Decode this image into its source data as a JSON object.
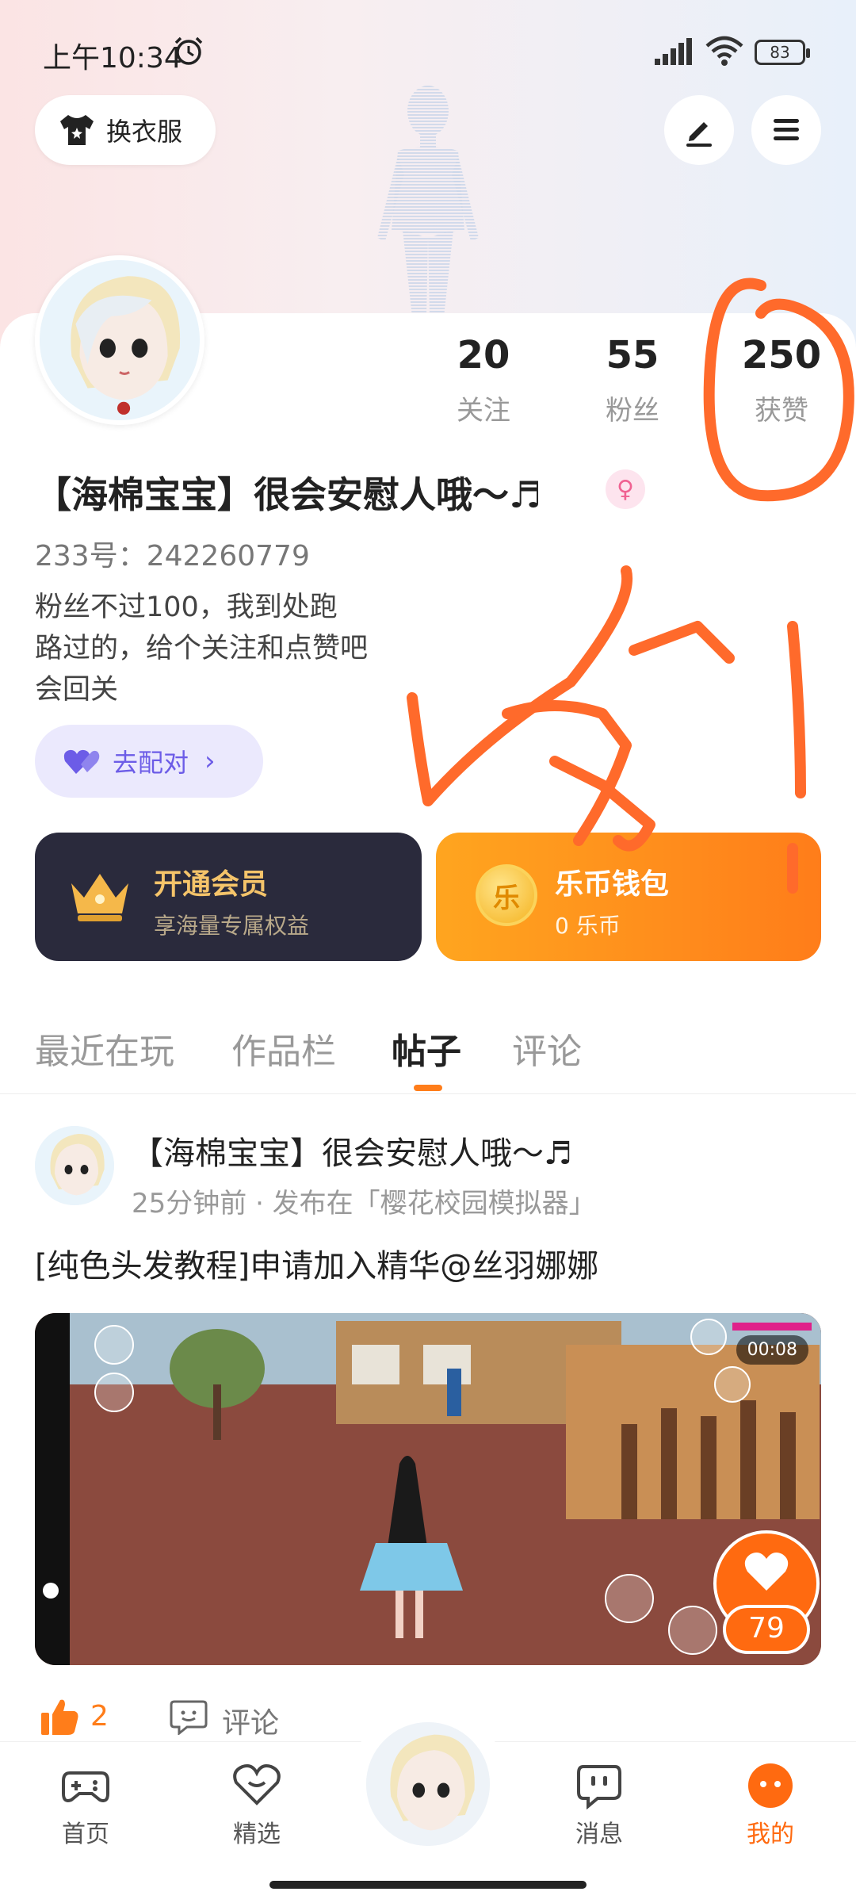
{
  "status_bar": {
    "time": "上午10:34",
    "battery": "83",
    "icons": [
      "alarm-icon",
      "signal-icon",
      "wifi-icon",
      "battery-icon"
    ]
  },
  "header": {
    "outfit_button": "换衣服",
    "icons": [
      "edit-icon",
      "menu-icon"
    ]
  },
  "profile": {
    "stats": [
      {
        "value": "20",
        "label": "关注"
      },
      {
        "value": "55",
        "label": "粉丝"
      },
      {
        "value": "250",
        "label": "获赞"
      }
    ],
    "nickname": "【海棉宝宝】很会安慰人哦～♬",
    "uid": "233号：242260779",
    "bio_lines": [
      "粉丝不过100，我到处跑",
      "路过的，给个关注和点赞吧",
      "会回关"
    ],
    "pair_button": "去配对"
  },
  "cards": {
    "vip_title": "开通会员",
    "vip_sub": "享海量专属权益",
    "wallet_title": "乐币钱包",
    "wallet_sub": "0 乐币",
    "coin_glyph": "乐"
  },
  "tabs": [
    {
      "label": "最近在玩",
      "active": false
    },
    {
      "label": "作品栏",
      "active": false
    },
    {
      "label": "帖子",
      "active": true
    },
    {
      "label": "评论",
      "active": false
    }
  ],
  "post": {
    "author": "【海棉宝宝】很会安慰人哦～♬",
    "meta": "25分钟前 · 发布在「樱花校园模拟器」",
    "title": "[纯色头发教程]申请加入精华@丝羽娜娜",
    "video_time": "00:08",
    "like_count_badge": "79",
    "likes": "2",
    "comment_label": "评论"
  },
  "bottom_nav": [
    {
      "label": "首页",
      "icon": "gamepad-icon",
      "active": false
    },
    {
      "label": "精选",
      "icon": "heart-chat-icon",
      "active": false
    },
    {
      "label": "消息",
      "icon": "message-icon",
      "active": false
    },
    {
      "label": "我的",
      "icon": "face-icon",
      "active": true
    }
  ],
  "colors": {
    "accent": "#ff6a10",
    "annotation": "#ff6a2b",
    "pair": "#6c5ce7"
  }
}
